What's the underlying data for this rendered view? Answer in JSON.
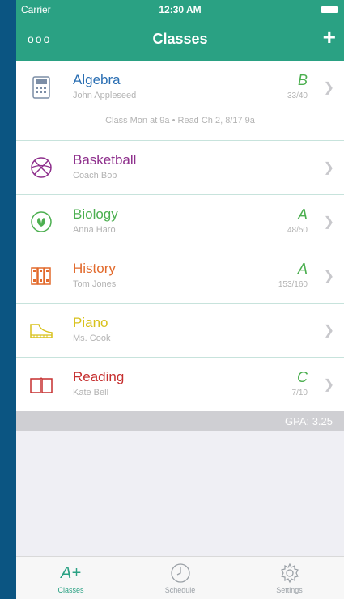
{
  "status_bar": {
    "carrier": "Carrier",
    "time": "12:30 AM"
  },
  "nav": {
    "title": "Classes",
    "more": "ooo",
    "add": "+"
  },
  "colors": {
    "header": "#2aa183",
    "accent": "#2aa183",
    "outer_bg": "#0b5582"
  },
  "classes": [
    {
      "icon": "calculator-icon",
      "name": "Algebra",
      "teacher": "John Appleseed",
      "grade": "B",
      "score": "33/40",
      "color": "#2b6fb3"
    },
    {
      "icon": "basketball-icon",
      "name": "Basketball",
      "teacher": "Coach Bob",
      "grade": "",
      "score": "",
      "color": "#8e2f8c"
    },
    {
      "icon": "leaf-icon",
      "name": "Biology",
      "teacher": "Anna Haro",
      "grade": "A",
      "score": "48/50",
      "color": "#4caf50"
    },
    {
      "icon": "books-icon",
      "name": "History",
      "teacher": "Tom Jones",
      "grade": "A",
      "score": "153/160",
      "color": "#e26a2c"
    },
    {
      "icon": "piano-icon",
      "name": "Piano",
      "teacher": "Ms. Cook",
      "grade": "",
      "score": "",
      "color": "#d8c11c"
    },
    {
      "icon": "open-book-icon",
      "name": "Reading",
      "teacher": "Kate Bell",
      "grade": "C",
      "score": "7/10",
      "color": "#c62f2f"
    }
  ],
  "algebra_note": "Class Mon at 9a • Read Ch 2, 8/17 9a",
  "gpa": "GPA:  3.25",
  "tabs": [
    {
      "label": "Classes",
      "icon": "a-plus-icon",
      "active": true
    },
    {
      "label": "Schedule",
      "icon": "clock-icon",
      "active": false
    },
    {
      "label": "Settings",
      "icon": "gear-icon",
      "active": false
    }
  ]
}
